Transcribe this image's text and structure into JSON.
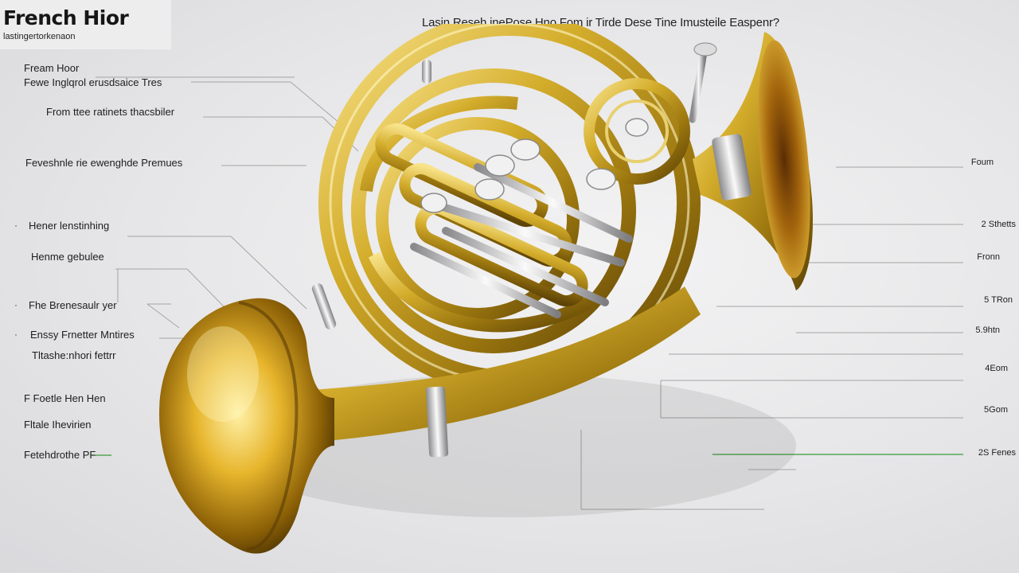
{
  "header": {
    "title": "French Hior",
    "subtitle": "lastingertorkenaon",
    "heading": "Lasin Reseh inePose Hno Fom ir  Tirde Dese Tine Imusteile Easpenr?"
  },
  "left_labels": [
    "Fream Hoor",
    "Fewe  Inglqrol erusdsaice Tres",
    "From ttee ratinets thacsbiler",
    "Feveshnle rie ewenghde Premues",
    "Hener lenstinhing",
    "Henme gebulee",
    "Fhe Brenesaulr yer",
    "Enssy Frnetter Mntires",
    "Tltashe:nhori fettrr",
    "F Foetle Hen Hen",
    "Fltale Ihevirien",
    "Fetehdrothe PF"
  ],
  "right_labels": [
    "Foum",
    "2 Sthetts",
    "Fronn",
    "5 TRon",
    "5.9htn",
    "4Eom",
    "5Gom",
    "2S Fenes"
  ],
  "colors": {
    "brass_light": "#f6dc7a",
    "brass_mid": "#c9a022",
    "brass_dark": "#6b4f08",
    "silver": "#e4e4e6",
    "accent_line": "#3a9a3a",
    "leader_line": "#9a9a9a"
  },
  "icons": [
    "french-horn-illustration"
  ]
}
